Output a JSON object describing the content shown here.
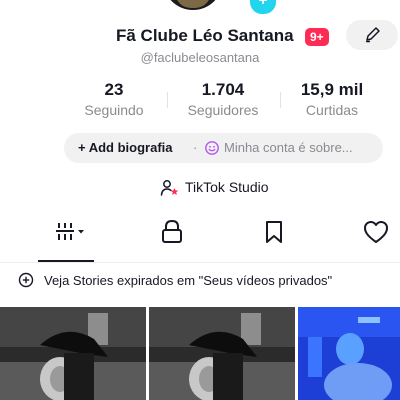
{
  "profile": {
    "name": "Fã Clube Léo Santana",
    "badge": "9+",
    "handle": "@faclubeleosantana"
  },
  "stats": [
    {
      "value": "23",
      "label": "Seguindo"
    },
    {
      "value": "1.704",
      "label": "Seguidores"
    },
    {
      "value": "15,9 mil",
      "label": "Curtidas"
    }
  ],
  "bio": {
    "add_label": "+ Add biografia",
    "separator": "·",
    "account_text": "Minha conta é sobre..."
  },
  "studio": {
    "label": "TikTok Studio"
  },
  "tabs": [
    {
      "icon": "grid-icon",
      "active": true
    },
    {
      "icon": "lock-icon",
      "active": false
    },
    {
      "icon": "bookmark-icon",
      "active": false
    },
    {
      "icon": "heart-icon",
      "active": false
    }
  ],
  "stories": {
    "text": "Veja Stories expirados em \"Seus vídeos privados\""
  },
  "colors": {
    "accent": "#fe2c55",
    "text": "#161823",
    "muted": "#8a8b91",
    "pill": "#f1f1f2",
    "verify": "#20d5ec"
  }
}
